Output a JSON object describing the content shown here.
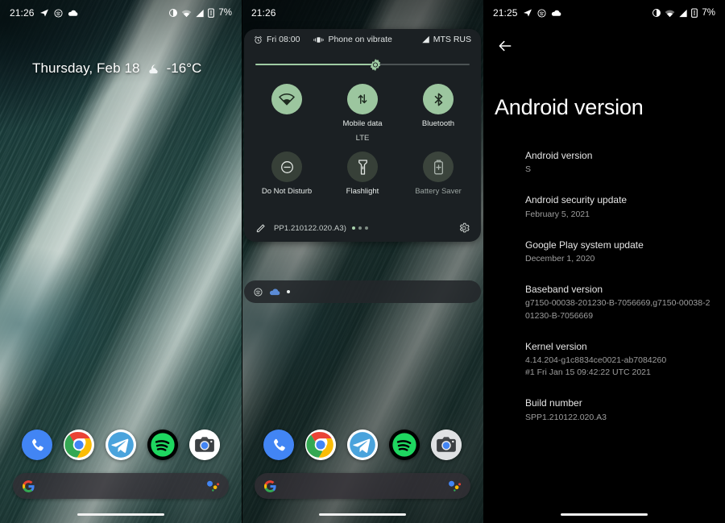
{
  "panels": {
    "home": {
      "status_bar": {
        "clock": "21:26",
        "left_icons": [
          "telegram-icon",
          "spotify-icon",
          "cloud-icon"
        ],
        "right_icons": [
          "do-not-disturb-icon",
          "wifi-icon",
          "signal-icon",
          "vibrate-battery-icon"
        ],
        "battery": "7%"
      },
      "widget": {
        "date": "Thursday, Feb 18",
        "weather_icon": "cloud-moon-icon",
        "temperature": "-16°C"
      },
      "dock": [
        {
          "name": "phone",
          "label": "Phone"
        },
        {
          "name": "chrome",
          "label": "Chrome"
        },
        {
          "name": "telegram",
          "label": "Telegram"
        },
        {
          "name": "spotify",
          "label": "Spotify"
        },
        {
          "name": "camera",
          "label": "Camera"
        }
      ],
      "search": {
        "placeholder": "",
        "left_icon": "google-g-icon",
        "right_icon": "google-assistant-icon"
      }
    },
    "quick_settings": {
      "status_bar": {
        "clock": "21:26"
      },
      "shade_header": {
        "alarm_icon": "alarm-icon",
        "alarm": "Fri 08:00",
        "ringer_icon": "vibrate-icon",
        "ringer": "Phone on vibrate",
        "carrier_icon": "signal-icon",
        "carrier": "MTS RUS"
      },
      "brightness": {
        "label": "Brightness",
        "value_percent": 56,
        "thumb_icon": "brightness-icon"
      },
      "tiles": [
        {
          "id": "wifi",
          "icon": "wifi-icon",
          "label": "",
          "sub": "",
          "state": "on"
        },
        {
          "id": "mobile-data",
          "icon": "mobile-data-icon",
          "label": "Mobile data",
          "sub": "LTE",
          "state": "on"
        },
        {
          "id": "bluetooth",
          "icon": "bluetooth-icon",
          "label": "Bluetooth",
          "sub": "",
          "state": "on"
        },
        {
          "id": "dnd",
          "icon": "do-not-disturb-icon",
          "label": "Do Not Disturb",
          "sub": "",
          "state": "off"
        },
        {
          "id": "flashlight",
          "icon": "flashlight-icon",
          "label": "Flashlight",
          "sub": "",
          "state": "off"
        },
        {
          "id": "battery-saver",
          "icon": "battery-saver-icon",
          "label": "Battery Saver",
          "sub": "",
          "state": "off"
        }
      ],
      "footer": {
        "edit_icon": "pencil-icon",
        "build": "PP1.210122.020.A3)",
        "page_dots": 3,
        "active_dot": 0,
        "settings_icon": "gear-icon"
      },
      "notification_strip": {
        "icons": [
          "spotify-icon",
          "cloud-icon"
        ]
      },
      "dock": [
        {
          "name": "phone",
          "label": "Phone"
        },
        {
          "name": "chrome",
          "label": "Chrome"
        },
        {
          "name": "telegram",
          "label": "Telegram"
        },
        {
          "name": "spotify",
          "label": "Spotify"
        },
        {
          "name": "camera",
          "label": "Camera"
        }
      ]
    },
    "android_version": {
      "status_bar": {
        "clock": "21:25",
        "battery": "7%"
      },
      "back_icon": "back-arrow-icon",
      "title": "Android version",
      "rows": [
        {
          "title": "Android version",
          "value": "S"
        },
        {
          "title": "Android security update",
          "value": "February 5, 2021"
        },
        {
          "title": "Google Play system update",
          "value": "December 1, 2020"
        },
        {
          "title": "Baseband version",
          "value": "g7150-00038-201230-B-7056669,g7150-00038-201230-B-7056669"
        },
        {
          "title": "Kernel version",
          "value": "4.14.204-g1c8834ce0021-ab7084260\n#1 Fri Jan 15 09:42:22 UTC 2021"
        },
        {
          "title": "Build number",
          "value": "SPP1.210122.020.A3"
        }
      ]
    }
  },
  "colors": {
    "accent_green": "#9cc69f",
    "tile_off": "#374038",
    "shade_bg": "#1b2023",
    "settings_bg": "#000000",
    "text_primary": "#e6e6e6",
    "text_secondary": "#9e9e9e"
  }
}
